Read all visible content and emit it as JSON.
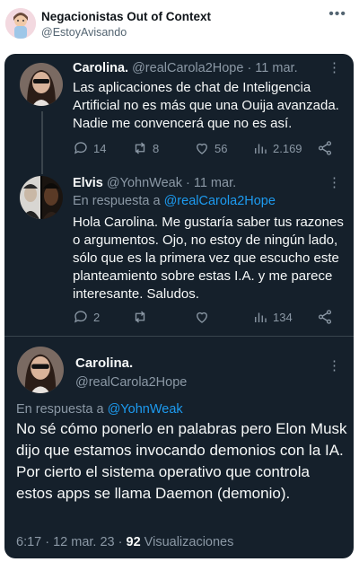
{
  "outer": {
    "account_name": "Negacionistas Out of Context",
    "account_handle": "@EstoyAvisando",
    "more_icon": "ellipsis-icon"
  },
  "tweets": [
    {
      "name": "Carolina.",
      "handle": "@realCarola2Hope",
      "date": "· 11 mar.",
      "text": "Las aplicaciones de chat de Inteligencia Artificial no es más que una Ouija avanzada. Nadie me convencerá que no es así.",
      "replies": "14",
      "retweets": "8",
      "likes": "56",
      "views": "2.169"
    },
    {
      "name": "Elvis",
      "handle": "@YohnWeak",
      "date": "· 11 mar.",
      "reply_prefix": "En respuesta a ",
      "reply_to": "@realCarola2Hope",
      "text": "Hola Carolina. Me gustaría saber tus razones o argumentos. Ojo, no estoy de ningún lado, sólo que es la primera vez que escucho este planteamiento sobre estas I.A. y me parece interesante. Saludos.",
      "replies": "2",
      "views": "134"
    }
  ],
  "main_tweet": {
    "name": "Carolina.",
    "handle": "@realCarola2Hope",
    "reply_prefix": "En respuesta a ",
    "reply_to": "@YohnWeak",
    "text": "No sé cómo ponerlo en palabras pero Elon Musk dijo que estamos invocando demonios con la IA. Por cierto el sistema operativo que controla estos apps se llama Daemon (demonio).",
    "timestamp": "6:17 · 12 mar. 23 · ",
    "views_count": "92",
    "views_label": " Visualizaciones"
  },
  "colors": {
    "card_bg": "#15202b",
    "text": "#f7f9f9",
    "muted": "#8b98a5",
    "link": "#1d9bf0"
  }
}
